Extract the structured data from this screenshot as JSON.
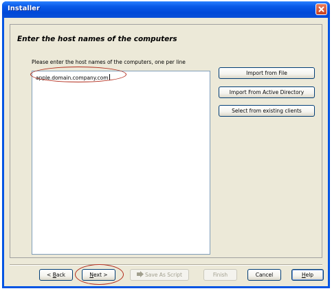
{
  "window": {
    "title": "Installer"
  },
  "page": {
    "heading": "Enter the host names of the computers",
    "instruction": "Please enter the host names of the computers, one per line",
    "host_value": "apple.domain.company.com"
  },
  "side_buttons": {
    "import_file": "Import from File",
    "import_ad": "Import From Active Directory",
    "select_existing": "Select from existing clients"
  },
  "footer": {
    "back_prefix": "< ",
    "back_key": "B",
    "back_rest": "ack",
    "next_key": "N",
    "next_rest": "ext >",
    "save_script": "Save As Script",
    "finish": "Finish",
    "cancel": "Cancel",
    "help_key": "H",
    "help_rest": "elp"
  },
  "colors": {
    "titlebar": "#0054e3",
    "dialog_bg": "#ece9d8",
    "highlight_oval": "#b22a1a"
  },
  "icons": {
    "close": "close-icon",
    "script": "script-arrow-icon"
  }
}
